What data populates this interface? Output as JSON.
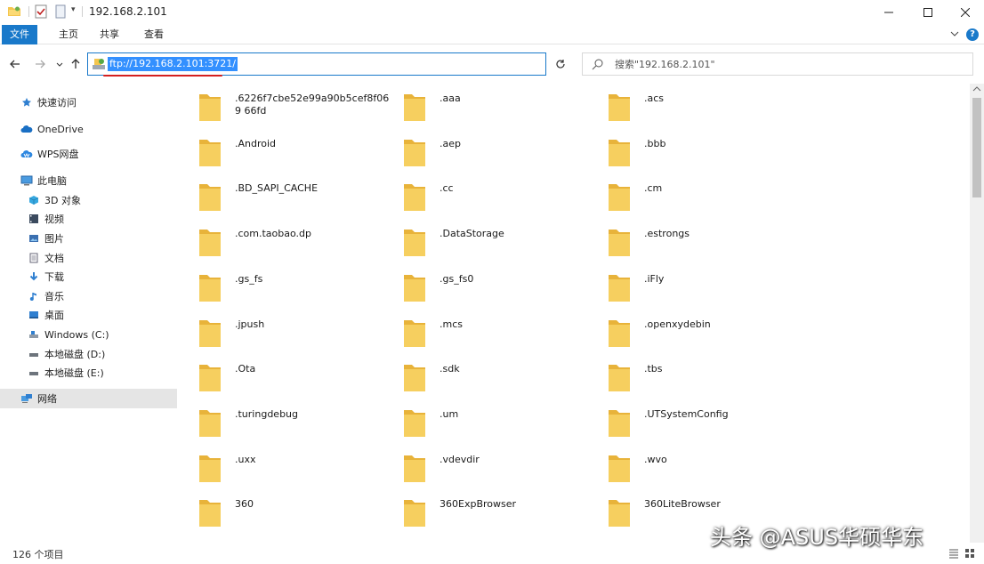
{
  "window": {
    "title": "192.168.2.101"
  },
  "ribbon": {
    "tabs": [
      "文件",
      "主页",
      "共享",
      "查看"
    ],
    "help": "?"
  },
  "nav": {
    "address": "ftp://192.168.2.101:3721/",
    "search_placeholder": "搜索\"192.168.2.101\""
  },
  "sidebar": {
    "items": [
      {
        "label": "快速访问",
        "icon": "star-icon"
      },
      {
        "label": "OneDrive",
        "icon": "cloud-icon"
      },
      {
        "label": "WPS网盘",
        "icon": "wps-cloud-icon"
      },
      {
        "label": "此电脑",
        "icon": "computer-icon"
      },
      {
        "label": "3D 对象",
        "icon": "cube-icon"
      },
      {
        "label": "视频",
        "icon": "video-icon"
      },
      {
        "label": "图片",
        "icon": "picture-icon"
      },
      {
        "label": "文档",
        "icon": "document-icon"
      },
      {
        "label": "下载",
        "icon": "download-icon"
      },
      {
        "label": "音乐",
        "icon": "music-icon"
      },
      {
        "label": "桌面",
        "icon": "desktop-icon"
      },
      {
        "label": "Windows (C:)",
        "icon": "drive-icon"
      },
      {
        "label": "本地磁盘 (D:)",
        "icon": "drive-icon"
      },
      {
        "label": "本地磁盘 (E:)",
        "icon": "drive-icon"
      },
      {
        "label": "网络",
        "icon": "network-icon"
      }
    ]
  },
  "files": [
    ".6226f7cbe52e99a90b5cef8f069 66fd",
    ".aaa",
    ".acs",
    ".Android",
    ".aep",
    ".bbb",
    ".BD_SAPI_CACHE",
    ".cc",
    ".cm",
    ".com.taobao.dp",
    ".DataStorage",
    ".estrongs",
    ".gs_fs",
    ".gs_fs0",
    ".iFly",
    ".jpush",
    ".mcs",
    ".openxydebin",
    ".Ota",
    ".sdk",
    ".tbs",
    ".turingdebug",
    ".um",
    ".UTSystemConfig",
    ".uxx",
    ".vdevdir",
    ".wvo",
    "360",
    "360ExpBrowser",
    "360LiteBrowser"
  ],
  "status": {
    "count": "126 个项目"
  },
  "watermark": "头条 @ASUS华硕华东",
  "colors": {
    "accent": "#1979ca",
    "folder": "#f4c64f",
    "selection": "#3390ff"
  }
}
